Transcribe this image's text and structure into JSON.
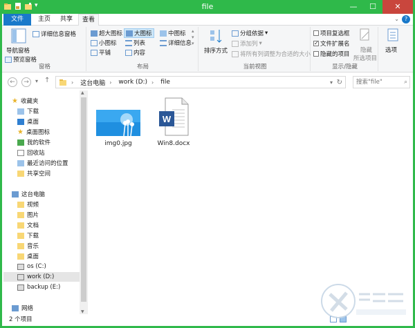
{
  "window": {
    "title": "file"
  },
  "tabs": [
    "文件",
    "主页",
    "共享",
    "查看"
  ],
  "ribbon": {
    "pane": {
      "nav_pane": "导航窗格",
      "preview_pane": "预览窗格",
      "details_pane": "详细信息窗格",
      "label": "窗格"
    },
    "layout": {
      "xl_icons": "超大图标",
      "large_icons": "大图标",
      "medium_icons": "中图标",
      "small_icons": "小图标",
      "list": "列表",
      "details": "详细信息",
      "tiles": "平铺",
      "content": "内容",
      "label": "布局"
    },
    "current_view": {
      "sort_by": "排序方式",
      "group_by": "分组依据",
      "add_column": "添加列",
      "size_all_columns": "将所有列调整为合适的大小",
      "label": "当前视图"
    },
    "show_hide": {
      "item_checkboxes": "项目复选框",
      "file_ext": "文件扩展名",
      "hidden_items": "隐藏的项目",
      "hide_selected": "隐藏",
      "selected_items": "所选项目",
      "label": "显示/隐藏",
      "item_checkboxes_checked": false,
      "file_ext_checked": true,
      "hidden_items_checked": false
    },
    "options": "选项"
  },
  "address": {
    "crumbs": [
      "这台电脑",
      "work (D:)",
      "file"
    ],
    "search_placeholder": "搜索\"file\""
  },
  "nav": {
    "favorites": "收藏夹",
    "fav_items": [
      "下载",
      "桌面",
      "桌面图标",
      "我的软件",
      "回收站",
      "最近访问的位置",
      "共享空间"
    ],
    "this_pc": "这台电脑",
    "pc_items": [
      "视频",
      "图片",
      "文档",
      "下载",
      "音乐",
      "桌面",
      "os (C:)",
      "work (D:)",
      "backup (E:)"
    ],
    "network": "网络"
  },
  "files": [
    {
      "name": "img0.jpg"
    },
    {
      "name": "Win8.docx"
    }
  ],
  "status": "2 个项目",
  "colors": {
    "accent": "#2fb94a",
    "file_tab": "#1979ca",
    "close": "#c9463d"
  }
}
